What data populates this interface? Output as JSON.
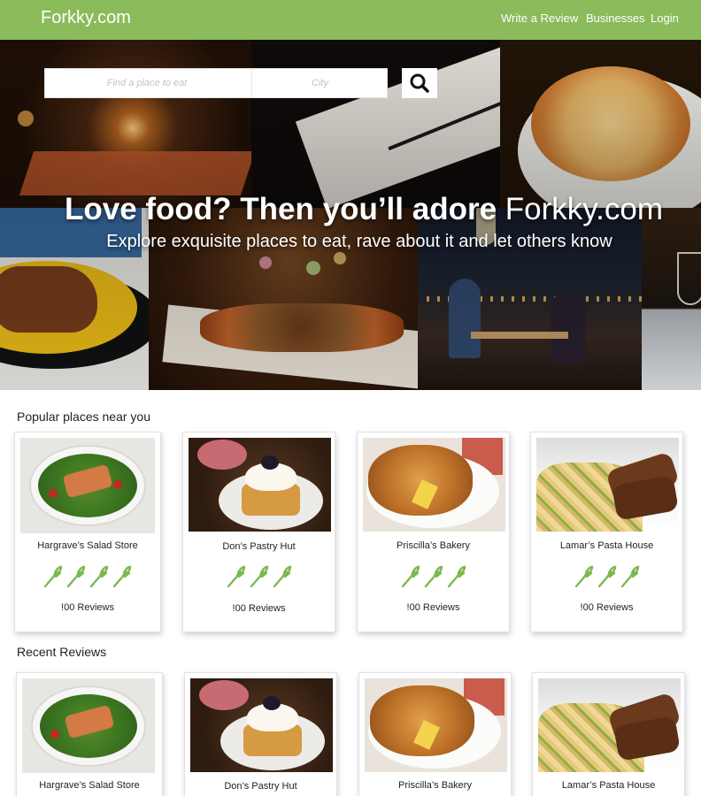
{
  "header": {
    "logo": "Forkky.com",
    "nav": [
      "Write a Review",
      "Businesses",
      "Login"
    ]
  },
  "search": {
    "place_placeholder": "Find a place to eat",
    "city_placeholder": "City",
    "button_icon": "search-icon"
  },
  "hero": {
    "headline_bold": "Love food? Then you’ll adore",
    "headline_brand": "Forkky.com",
    "subline": "Explore exquisite places to eat, rave about it and let others know"
  },
  "popular": {
    "title": "Popular places near you",
    "items": [
      {
        "name": "Hargrave’s Salad Store",
        "reviews": "!00 Reviews",
        "rating": 4,
        "photo": "salad-photo"
      },
      {
        "name": "Don’s Pastry Hut",
        "reviews": "!00 Reviews",
        "rating": 3,
        "photo": "waffle-photo"
      },
      {
        "name": "Priscilla’s Bakery",
        "reviews": "!00 Reviews",
        "rating": 3,
        "photo": "fried-food-photo"
      },
      {
        "name": "Lamar’s Pasta House",
        "reviews": "!00 Reviews",
        "rating": 3,
        "photo": "pasta-photo"
      }
    ]
  },
  "recent": {
    "title": "Recent Reviews",
    "items": [
      {
        "name": "Hargrave’s Salad Store",
        "photo": "salad-photo"
      },
      {
        "name": "Don’s Pastry Hut",
        "photo": "waffle-photo"
      },
      {
        "name": "Priscilla’s Bakery",
        "photo": "fried-food-photo"
      },
      {
        "name": "Lamar’s Pasta House",
        "photo": "pasta-photo"
      }
    ]
  },
  "colors": {
    "brand_green": "#8bbb5a",
    "fork_green": "#7cb84f",
    "header_text": "#ffffff"
  },
  "icons": {
    "rating": "fork-icon",
    "search": "search-icon"
  }
}
